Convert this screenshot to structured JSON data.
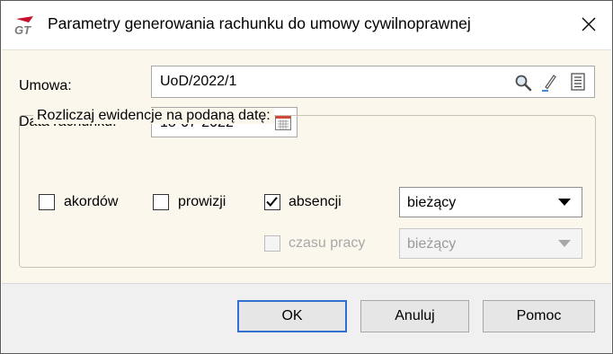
{
  "dialog": {
    "title": "Parametry generowania rachunku do umowy cywilnoprawnej",
    "app_icon": "comarch-logo-icon",
    "close_icon": "close-icon"
  },
  "form": {
    "contract_label": "Umowa:",
    "contract_value": "UoD/2022/1",
    "contract_icons": [
      "search-icon",
      "edit-pencil-icon",
      "list-icon"
    ],
    "date_label": "Data rachunku:",
    "date_value": "18-07-2022",
    "date_icon": "calendar-icon"
  },
  "group": {
    "title": "Rozliczaj ewidencje na podaną datę:",
    "checkboxes": [
      {
        "label": "akordów",
        "checked": false,
        "enabled": true
      },
      {
        "label": "prowizji",
        "checked": false,
        "enabled": true
      },
      {
        "label": "absencji",
        "checked": true,
        "enabled": true
      },
      {
        "label": "czasu pracy",
        "checked": false,
        "enabled": false
      }
    ],
    "absence_period": "bieżący",
    "worktime_period": "bieżący"
  },
  "buttons": {
    "ok": "OK",
    "cancel": "Anuluj",
    "help": "Pomoc"
  },
  "colors": {
    "client_bg": "#fcf7ed",
    "footer_bg": "#f0f0f0",
    "default_button_border": "#2f70d0",
    "logo_red": "#c8102e"
  }
}
